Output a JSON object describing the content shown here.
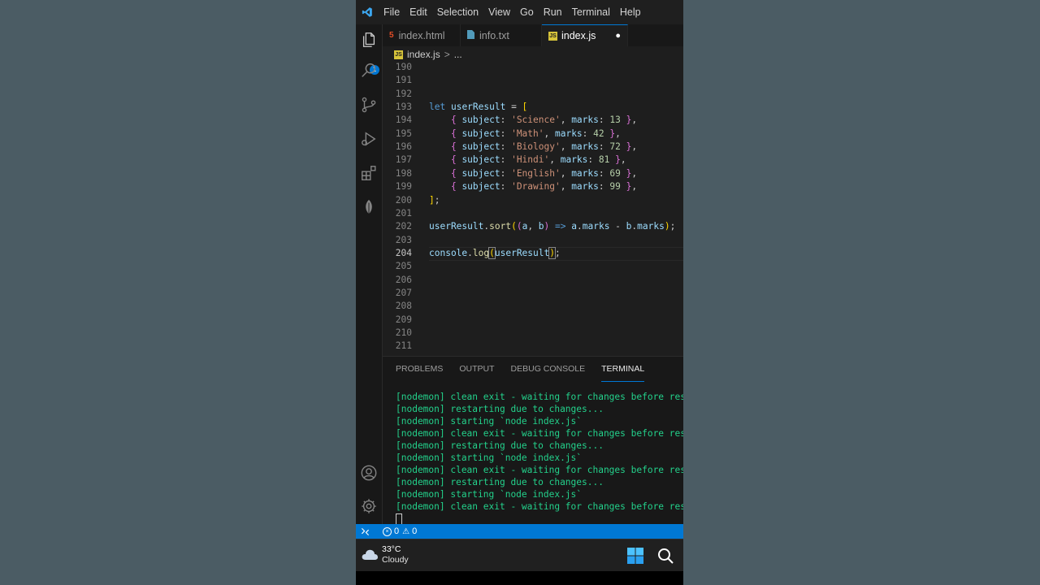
{
  "menu": [
    "File",
    "Edit",
    "Selection",
    "View",
    "Go",
    "Run",
    "Terminal",
    "Help"
  ],
  "tabs": [
    {
      "label": "index.html",
      "icon": "html5-icon",
      "color": "#e44d26"
    },
    {
      "label": "info.txt",
      "icon": "file-icon",
      "color": "#519aba"
    },
    {
      "label": "index.js",
      "icon": "js-icon",
      "color": "#d7c43a",
      "active": true,
      "modified": true
    }
  ],
  "explorer_badge": "1",
  "breadcrumb": {
    "file": "index.js",
    "sep": ">",
    "rest": "..."
  },
  "editor": {
    "current_line": "204",
    "lines": [
      {
        "n": "190"
      },
      {
        "n": "191"
      },
      {
        "n": "192"
      },
      {
        "n": "193"
      },
      {
        "n": "194",
        "subject": "'Science'",
        "marks": "13"
      },
      {
        "n": "195",
        "subject": "'Math'",
        "marks": "42"
      },
      {
        "n": "196",
        "subject": "'Biology'",
        "marks": "72"
      },
      {
        "n": "197",
        "subject": "'Hindi'",
        "marks": "81"
      },
      {
        "n": "198",
        "subject": "'English'",
        "marks": "69"
      },
      {
        "n": "199",
        "subject": "'Drawing'",
        "marks": "99"
      },
      {
        "n": "200"
      },
      {
        "n": "201"
      },
      {
        "n": "202"
      },
      {
        "n": "203"
      },
      {
        "n": "204"
      },
      {
        "n": "205"
      },
      {
        "n": "206"
      },
      {
        "n": "207"
      },
      {
        "n": "208"
      },
      {
        "n": "209"
      },
      {
        "n": "210"
      },
      {
        "n": "211"
      }
    ],
    "tokens": {
      "let": "let",
      "varname": "userResult",
      "eq": " = ",
      "open_arr": "[",
      "close_arr": "]",
      "semi": ";",
      "open_obj": "{ ",
      "close_obj": " }",
      "subject_key": "subject",
      "marks_key": "marks",
      "colon": ": ",
      "comma": ", ",
      "sort_fn": "sort",
      "a": "a",
      "b": "b",
      "arrow": " => ",
      "dot": ".",
      "minus": " - ",
      "console": "console",
      "log": "log",
      "lparen": "(",
      "rparen": ")"
    }
  },
  "panel": {
    "tabs": [
      "PROBLEMS",
      "OUTPUT",
      "DEBUG CONSOLE",
      "TERMINAL"
    ],
    "active": "TERMINAL",
    "terminal_lines": [
      "[nodemon] clean exit - waiting for changes before resta",
      "[nodemon] restarting due to changes...",
      "[nodemon] starting `node index.js`",
      "[nodemon] clean exit - waiting for changes before resta",
      "[nodemon] restarting due to changes...",
      "[nodemon] starting `node index.js`",
      "[nodemon] clean exit - waiting for changes before resta",
      "[nodemon] restarting due to changes...",
      "[nodemon] starting `node index.js`",
      "[nodemon] clean exit - waiting for changes before resta"
    ]
  },
  "status": {
    "errors": "0",
    "warnings": "0"
  },
  "taskbar": {
    "temperature": "33°C",
    "weather": "Cloudy"
  },
  "colors": {
    "accent": "#0078d4",
    "terminal_text": "#23d18b",
    "editor_bg": "#1e1e1e"
  }
}
